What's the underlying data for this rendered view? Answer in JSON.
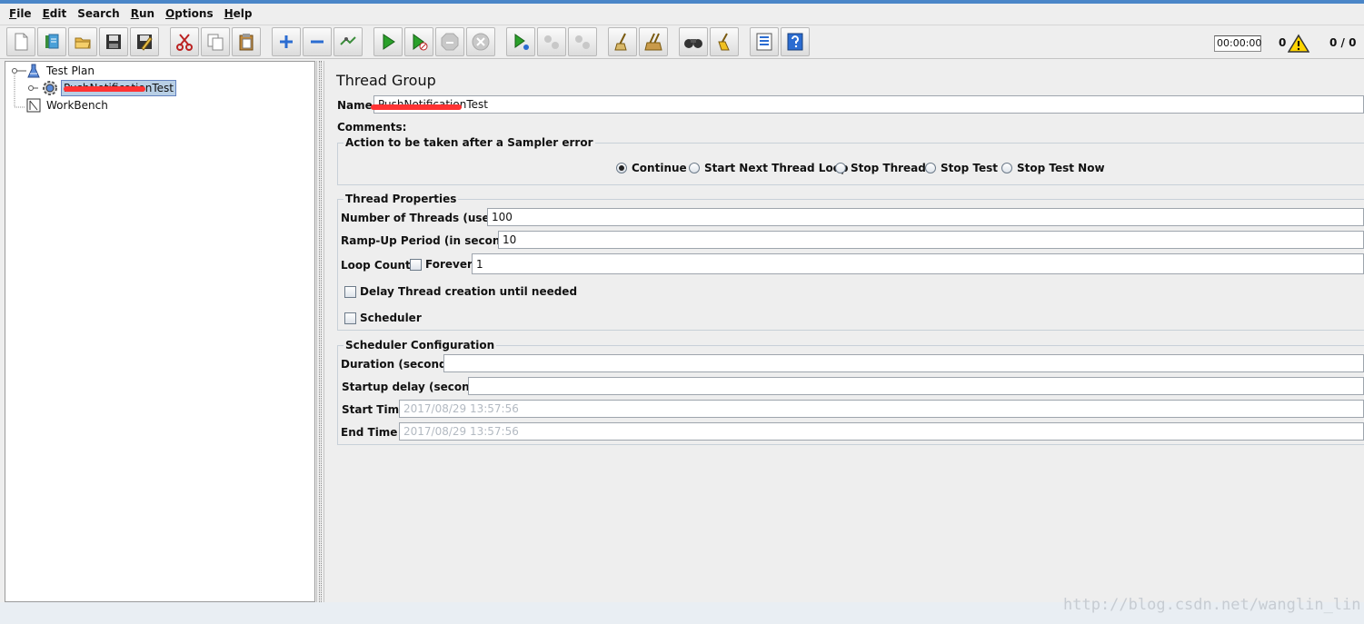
{
  "menubar": [
    {
      "mn": "F",
      "rest": "ile"
    },
    {
      "mn": "E",
      "rest": "dit"
    },
    {
      "mn": "",
      "rest": "Search"
    },
    {
      "mn": "R",
      "rest": "un"
    },
    {
      "mn": "O",
      "rest": "ptions"
    },
    {
      "mn": "H",
      "rest": "elp"
    }
  ],
  "toolbar": {
    "buttons": [
      "new-icon",
      "templates-icon",
      "open-icon",
      "save-icon",
      "save-as-icon",
      "cut-icon",
      "copy-icon",
      "paste-icon",
      "expand-icon",
      "collapse-icon",
      "toggle-icon",
      "start-icon",
      "start-no-pauses-icon",
      "stop-icon",
      "shutdown-icon",
      "remote-start-icon",
      "remote-stop-icon",
      "remote-shutdown-icon",
      "clear-icon",
      "clear-all-icon",
      "search-icon",
      "reset-search-icon",
      "function-helper-icon",
      "help-icon"
    ]
  },
  "status": {
    "time": "00:00:00",
    "warnings": "0",
    "threads": "0 / 0"
  },
  "tree": {
    "test_plan": "Test Plan",
    "thread_group": "PushNotificationTest",
    "workbench": "WorkBench"
  },
  "panel": {
    "title": "Thread Group",
    "name_label": "Name:",
    "name_value": "PushNotificationTest",
    "comments_label": "Comments:",
    "error_action": {
      "legend": "Action to be taken after a Sampler error",
      "options": [
        "Continue",
        "Start Next Thread Loop",
        "Stop Thread",
        "Stop Test",
        "Stop Test Now"
      ],
      "selected": "Continue"
    },
    "thread_props": {
      "legend": "Thread Properties",
      "threads_label": "Number of Threads (users):",
      "threads_value": "100",
      "rampup_label": "Ramp-Up Period (in seconds):",
      "rampup_value": "10",
      "loop_label": "Loop Count:",
      "forever_label": "Forever",
      "loop_value": "1",
      "delay_label": "Delay Thread creation until needed",
      "scheduler_label": "Scheduler"
    },
    "scheduler": {
      "legend": "Scheduler Configuration",
      "duration_label": "Duration (seconds)",
      "duration_value": "",
      "startup_label": "Startup delay (seconds)",
      "startup_value": "",
      "start_label": "Start Time",
      "start_value": "2017/08/29 13:57:56",
      "end_label": "End Time",
      "end_value": "2017/08/29 13:57:56"
    }
  },
  "watermark": "http://blog.csdn.net/wanglin_lin",
  "colors": {
    "selection": "#b8cfe5",
    "redaction": "#ff3333",
    "accent": "#4a86c8"
  }
}
